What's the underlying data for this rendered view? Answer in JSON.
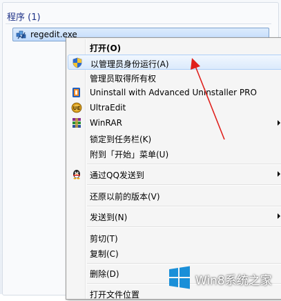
{
  "search": {
    "group_header": "程序 (1)",
    "result": {
      "name": "regedit.exe",
      "icon": "registry-editor-icon"
    }
  },
  "menu": {
    "items": [
      {
        "label": "打开(O)",
        "icon": "",
        "bold": true,
        "highlighted": false,
        "submenu": false
      },
      {
        "label": "以管理员身份运行(A)",
        "icon": "uac-shield-icon",
        "bold": false,
        "highlighted": true,
        "submenu": false
      },
      {
        "label": "管理员取得所有权",
        "icon": "",
        "bold": false,
        "highlighted": false,
        "submenu": false
      },
      {
        "label": "Uninstall with Advanced Uninstaller PRO",
        "icon": "advanced-uninstaller-icon",
        "bold": false,
        "highlighted": false,
        "submenu": false
      },
      {
        "label": "UltraEdit",
        "icon": "ultraedit-icon",
        "bold": false,
        "highlighted": false,
        "submenu": false
      },
      {
        "label": "WinRAR",
        "icon": "winrar-icon",
        "bold": false,
        "highlighted": false,
        "submenu": true
      },
      {
        "label": "锁定到任务栏(K)",
        "icon": "",
        "bold": false,
        "highlighted": false,
        "submenu": false
      },
      {
        "label": "附到「开始」菜单(U)",
        "icon": "",
        "bold": false,
        "highlighted": false,
        "submenu": false
      },
      {
        "label": "通过QQ发送到",
        "icon": "qq-penguin-icon",
        "bold": false,
        "highlighted": false,
        "submenu": true
      },
      {
        "label": "还原以前的版本(V)",
        "icon": "",
        "bold": false,
        "highlighted": false,
        "submenu": false
      },
      {
        "label": "发送到(N)",
        "icon": "",
        "bold": false,
        "highlighted": false,
        "submenu": true
      },
      {
        "label": "剪切(T)",
        "icon": "",
        "bold": false,
        "highlighted": false,
        "submenu": false
      },
      {
        "label": "复制(C)",
        "icon": "",
        "bold": false,
        "highlighted": false,
        "submenu": false
      },
      {
        "label": "删除(D)",
        "icon": "",
        "bold": false,
        "highlighted": false,
        "submenu": false
      },
      {
        "label": "打开文件位置",
        "icon": "",
        "bold": false,
        "highlighted": false,
        "submenu": false
      }
    ]
  },
  "watermark": {
    "text": "Win8系统之家",
    "icon": "windows-logo-icon"
  },
  "annotation": {
    "icon": "red-arrow-icon",
    "color": "#e0201c"
  },
  "colors": {
    "highlight": "#dbeafc",
    "group_header": "#1e3287",
    "windows_blue": "#1a8fd8"
  }
}
